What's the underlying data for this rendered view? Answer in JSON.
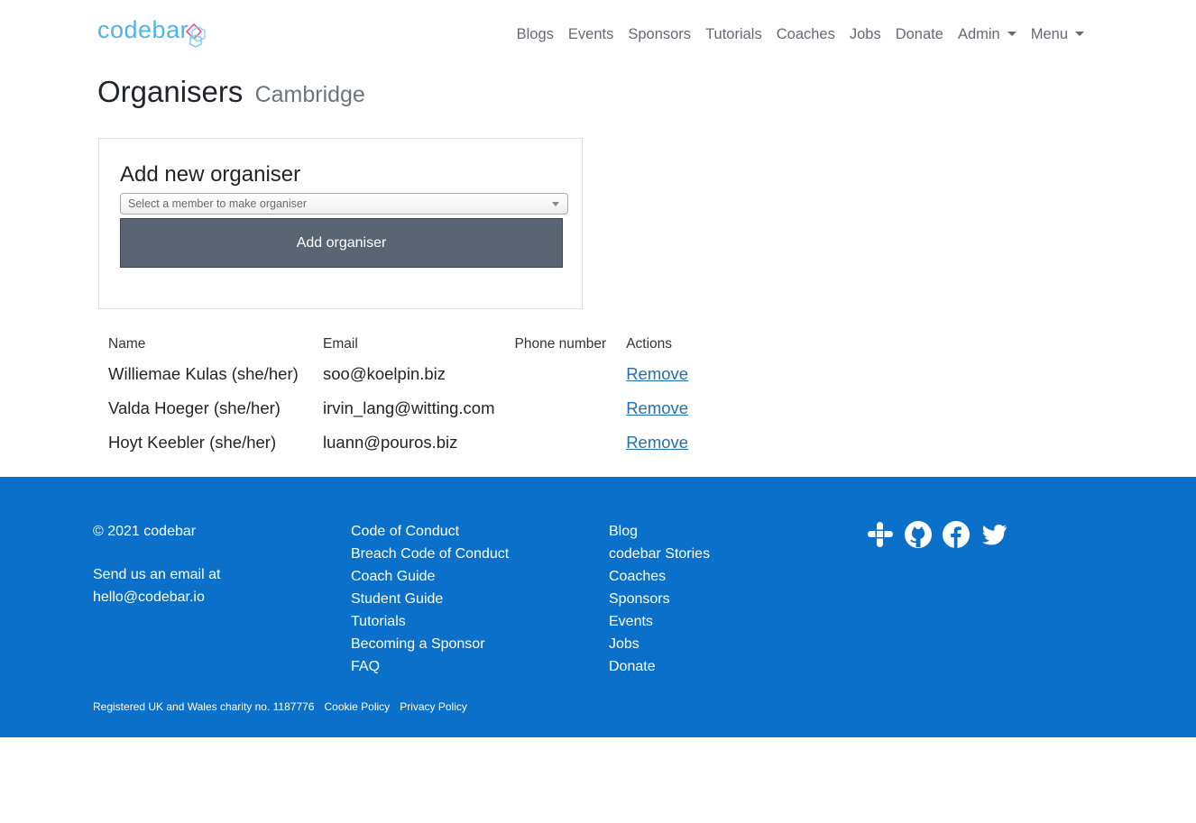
{
  "brand": {
    "name": "codebar",
    "color": "#4fb3e8"
  },
  "nav": {
    "items": [
      "Blogs",
      "Events",
      "Sponsors",
      "Tutorials",
      "Coaches",
      "Jobs",
      "Donate"
    ],
    "admin": "Admin",
    "menu": "Menu"
  },
  "page": {
    "title": "Organisers",
    "subtitle": "Cambridge"
  },
  "form": {
    "heading": "Add new organiser",
    "select_placeholder": "Select a member to make organiser",
    "button_label": "Add organiser"
  },
  "table": {
    "headers": [
      "Name",
      "Email",
      "Phone number",
      "Actions"
    ],
    "rows": [
      {
        "name": "Williemae Kulas (she/her)",
        "email": "soo@koelpin.biz",
        "phone": "",
        "action": "Remove"
      },
      {
        "name": "Valda Hoeger (she/her)",
        "email": "irvin_lang@witting.com",
        "phone": "",
        "action": "Remove"
      },
      {
        "name": "Hoyt Keebler (she/her)",
        "email": "luann@pouros.biz",
        "phone": "",
        "action": "Remove"
      }
    ]
  },
  "footer": {
    "copyright": "© 2021 codebar",
    "email_intro": "Send us an email at",
    "email": "hello@codebar.io",
    "links_col1": [
      "Code of Conduct",
      "Breach Code of Conduct",
      "Coach Guide",
      "Student Guide",
      "Tutorials",
      "Becoming a Sponsor",
      "FAQ"
    ],
    "links_col2": [
      "Blog",
      "codebar Stories",
      "Coaches",
      "Sponsors",
      "Events",
      "Jobs",
      "Donate"
    ],
    "social_icons": [
      "slack-icon",
      "github-icon",
      "facebook-icon",
      "twitter-icon"
    ],
    "charity": "Registered UK and Wales charity no. 1187776",
    "cookie": "Cookie Policy",
    "privacy": "Privacy Policy",
    "background": "#0a70c9"
  }
}
